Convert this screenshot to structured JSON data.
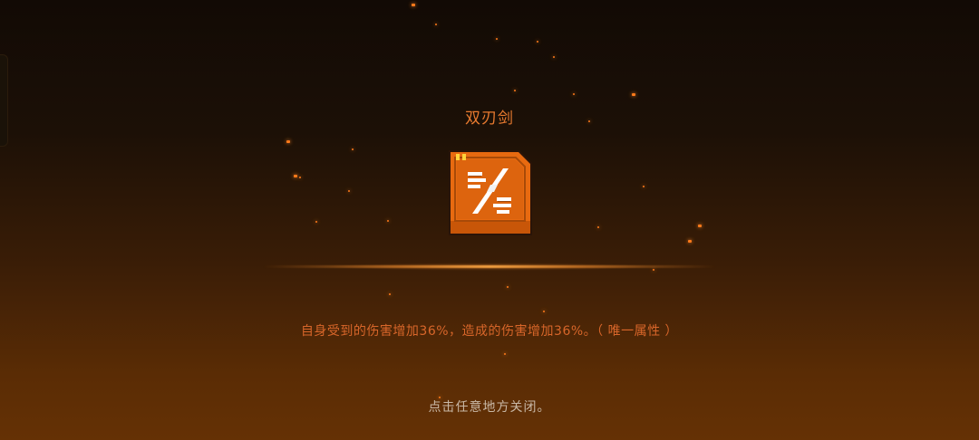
{
  "item": {
    "name": "双刃剑",
    "icon": "dual-blade-icon",
    "description": "自身受到的伤害增加36%，造成的伤害增加36%。（ 唯一属性 ）"
  },
  "close_hint": "点击任意地方关闭。",
  "colors": {
    "title": "#e87a2f",
    "description": "#d8662a",
    "card_fill": "#e86a10",
    "spark": "#ff7a1a"
  }
}
